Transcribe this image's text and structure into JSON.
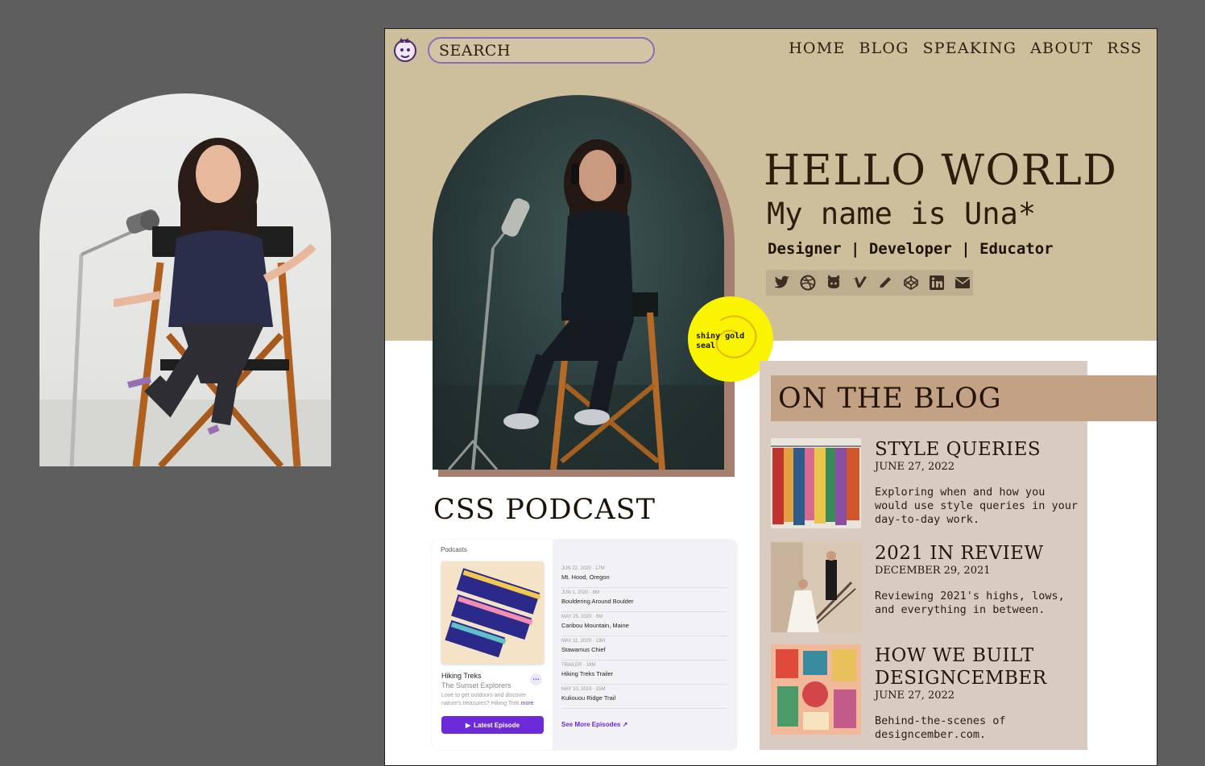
{
  "side_photo": {
    "alt": ""
  },
  "header": {
    "search_placeholder": "SEARCH",
    "nav": [
      {
        "label": "HOME"
      },
      {
        "label": "BLOG"
      },
      {
        "label": "SPEAKING"
      },
      {
        "label": "ABOUT"
      },
      {
        "label": "RSS"
      }
    ]
  },
  "hero": {
    "seal_text": "shiny gold seal",
    "headline": "HELLO WORLD",
    "name_line": "My name is Una*",
    "roles": "Designer | Developer | Educator",
    "social_icons": [
      "twitter-icon",
      "dribbble-icon",
      "github-icon",
      "vimeo-icon",
      "pencil-icon",
      "codepen-icon",
      "linkedin-icon",
      "mail-icon"
    ]
  },
  "blog": {
    "title": "ON THE BLOG",
    "posts": [
      {
        "title": "STYLE QUERIES",
        "date": "JUNE 27, 2022",
        "desc": "Exploring when and how you would use style queries in your day-to-day work."
      },
      {
        "title": "2021 IN REVIEW",
        "date": "DECEMBER 29, 2021",
        "desc": "Reviewing 2021's highs, lows, and everything in between."
      },
      {
        "title": "HOW WE BUILT DESIGNCEMBER",
        "date": "JUNE 27, 2022",
        "desc": "Behind-the-scenes of designcember.com."
      }
    ]
  },
  "podcast": {
    "title": "CSS PODCAST",
    "brand": "Podcasts",
    "show": "Hiking Treks",
    "author": "The Sunset Explorers",
    "desc": "Love to get outdoors and discover nature's treasures? Hiking Trek",
    "more": "more",
    "latest_button": "Latest Episode",
    "episodes": [
      {
        "meta": "JUN 22, 2020 · 17M",
        "title": "Mt. Hood, Oregon"
      },
      {
        "meta": "JUN 1, 2020 · 6M",
        "title": "Bouldering Around Boulder"
      },
      {
        "meta": "MAY 25, 2020 · 5M",
        "title": "Caribou Mountain, Maine"
      },
      {
        "meta": "MAY 11, 2020 · 13M",
        "title": "Stawamus Chief"
      },
      {
        "meta": "TRAILER · 18M",
        "title": "Hiking Treks Trailer"
      },
      {
        "meta": "MAY 10, 2019 · 15M",
        "title": "Kuliouou Ridge Trail"
      }
    ],
    "see_more": "See More Episodes ↗"
  },
  "colors": {
    "hero_bg": "#cdbe9c",
    "arch_shadow": "#a67f6f",
    "seal": "#fbf400",
    "blog_card": "#d9cbc0",
    "blog_title_bar": "#c2a184",
    "search_border": "#8a6fb8",
    "podcast_accent": "#6c2ad8",
    "desktop_bg": "#5e5e5e"
  }
}
